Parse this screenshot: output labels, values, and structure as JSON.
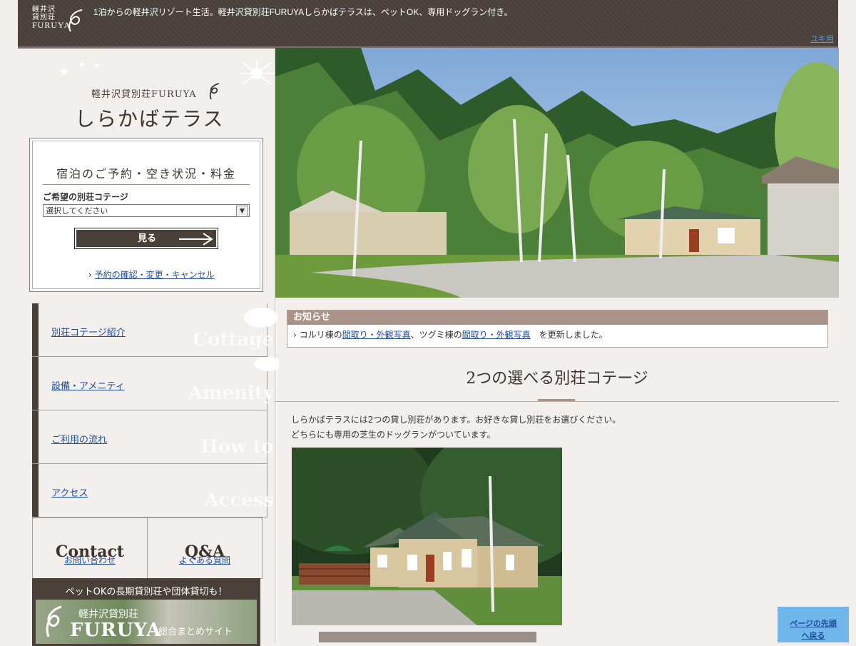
{
  "header": {
    "logo_line1": "軽井沢",
    "logo_line2": "貸別荘",
    "logo_line3": "FURUYA",
    "tagline": "1泊からの軽井沢リゾート生活。軽井沢貸別荘FURUYAしらかばテラスは、ペットOK、専用ドッグラン付き。",
    "top_link": "ユキ用"
  },
  "brand": {
    "sub": "軽井沢貸別荘FURUYA",
    "name": "しらかばテラス"
  },
  "booking": {
    "title": "宿泊のご予約・空き状況・料金",
    "label": "ご希望の別荘コテージ",
    "select_value": "選択してください",
    "button_label": "見る",
    "manage_link": "予約の確認・変更・キャンセル"
  },
  "nav": [
    {
      "label": "別荘コテージ紹介",
      "ghost": "Cottage"
    },
    {
      "label": "設備・アメニティ",
      "ghost": "Amenity"
    },
    {
      "label": "ご利用の流れ",
      "ghost": "How to"
    },
    {
      "label": "アクセス",
      "ghost": "Access"
    }
  ],
  "buttons": {
    "contact_big": "Contact",
    "contact_link": "お問い合わせ",
    "qa_big": "Q&A",
    "qa_link": "よくある質問"
  },
  "banner": {
    "text": "ペットOKの長期貸別荘や団体貸切も！",
    "img_line1": "軽井沢貸別荘",
    "img_line2": "FURUYA",
    "img_line3": "総合まとめサイト"
  },
  "notice": {
    "heading": "お知らせ",
    "prefix": "› コルリ棟の",
    "link1": "間取り・外観写真",
    "mid": "、ツグミ棟の",
    "link2": "間取り・外観写真",
    "suffix": "　を更新しました。"
  },
  "section": {
    "title": "2つの選べる別荘コテージ",
    "intro1": "しらかばテラスには2つの貸し別荘があります。お好きな貸し別荘をお選びください。",
    "intro2": "どちらにも専用の芝生のドッグランがついています。"
  },
  "pagetop": {
    "line1": "ページの先頭",
    "line2": "へ戻る"
  },
  "colors": {
    "dark_brown": "#4a403a",
    "accent_mauve": "#ab9288",
    "background": "#f3efec",
    "link_blue": "#1f4e9c",
    "pagetop_blue": "#6fb6ea"
  }
}
